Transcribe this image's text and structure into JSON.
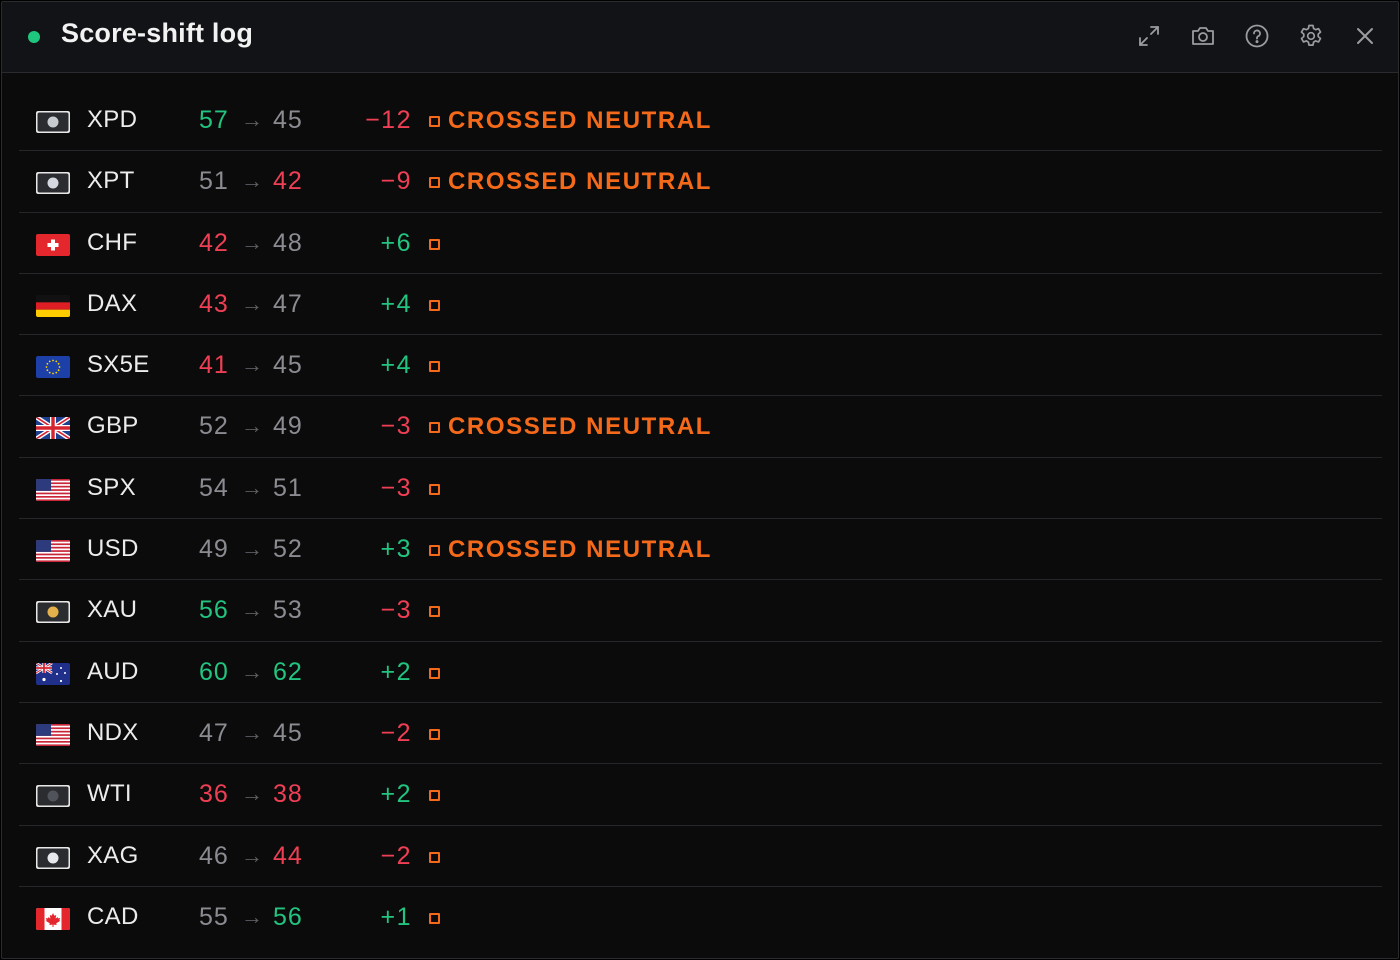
{
  "header": {
    "title": "Score-shift log",
    "status_color": "#1fc77e",
    "icons": [
      "expand-icon",
      "camera-icon",
      "help-icon",
      "settings-icon",
      "close-icon"
    ]
  },
  "colors": {
    "up": "#22c47f",
    "down": "#ef3f55",
    "neutral": "#8a8c91",
    "alert": "#f56a1a"
  },
  "columns": [
    "symbol",
    "from",
    "to",
    "delta",
    "status"
  ],
  "rows": [
    {
      "symbol": "XPD",
      "flag": "metal-palladium",
      "from": "57",
      "from_tone": "green",
      "to": "45",
      "to_tone": "gray",
      "delta": "−12",
      "delta_tone": "red",
      "note": "CROSSED NEUTRAL"
    },
    {
      "symbol": "XPT",
      "flag": "metal-platinum",
      "from": "51",
      "from_tone": "gray",
      "to": "42",
      "to_tone": "red",
      "delta": "−9",
      "delta_tone": "red",
      "note": "CROSSED NEUTRAL"
    },
    {
      "symbol": "CHF",
      "flag": "switzerland",
      "from": "42",
      "from_tone": "red",
      "to": "48",
      "to_tone": "gray",
      "delta": "+6",
      "delta_tone": "green",
      "note": ""
    },
    {
      "symbol": "DAX",
      "flag": "germany",
      "from": "43",
      "from_tone": "red",
      "to": "47",
      "to_tone": "gray",
      "delta": "+4",
      "delta_tone": "green",
      "note": ""
    },
    {
      "symbol": "SX5E",
      "flag": "european-union",
      "from": "41",
      "from_tone": "red",
      "to": "45",
      "to_tone": "gray",
      "delta": "+4",
      "delta_tone": "green",
      "note": ""
    },
    {
      "symbol": "GBP",
      "flag": "united-kingdom",
      "from": "52",
      "from_tone": "gray",
      "to": "49",
      "to_tone": "gray",
      "delta": "−3",
      "delta_tone": "red",
      "note": "CROSSED NEUTRAL"
    },
    {
      "symbol": "SPX",
      "flag": "united-states",
      "from": "54",
      "from_tone": "gray",
      "to": "51",
      "to_tone": "gray",
      "delta": "−3",
      "delta_tone": "red",
      "note": ""
    },
    {
      "symbol": "USD",
      "flag": "united-states",
      "from": "49",
      "from_tone": "gray",
      "to": "52",
      "to_tone": "gray",
      "delta": "+3",
      "delta_tone": "green",
      "note": "CROSSED NEUTRAL"
    },
    {
      "symbol": "XAU",
      "flag": "metal-gold",
      "from": "56",
      "from_tone": "green",
      "to": "53",
      "to_tone": "gray",
      "delta": "−3",
      "delta_tone": "red",
      "note": ""
    },
    {
      "symbol": "AUD",
      "flag": "australia",
      "from": "60",
      "from_tone": "green",
      "to": "62",
      "to_tone": "green",
      "delta": "+2",
      "delta_tone": "green",
      "note": ""
    },
    {
      "symbol": "NDX",
      "flag": "united-states",
      "from": "47",
      "from_tone": "gray",
      "to": "45",
      "to_tone": "gray",
      "delta": "−2",
      "delta_tone": "red",
      "note": ""
    },
    {
      "symbol": "WTI",
      "flag": "oil",
      "from": "36",
      "from_tone": "red",
      "to": "38",
      "to_tone": "red",
      "delta": "+2",
      "delta_tone": "green",
      "note": ""
    },
    {
      "symbol": "XAG",
      "flag": "metal-silver",
      "from": "46",
      "from_tone": "gray",
      "to": "44",
      "to_tone": "red",
      "delta": "−2",
      "delta_tone": "red",
      "note": ""
    },
    {
      "symbol": "CAD",
      "flag": "canada",
      "from": "55",
      "from_tone": "gray",
      "to": "56",
      "to_tone": "green",
      "delta": "+1",
      "delta_tone": "green",
      "note": ""
    }
  ]
}
